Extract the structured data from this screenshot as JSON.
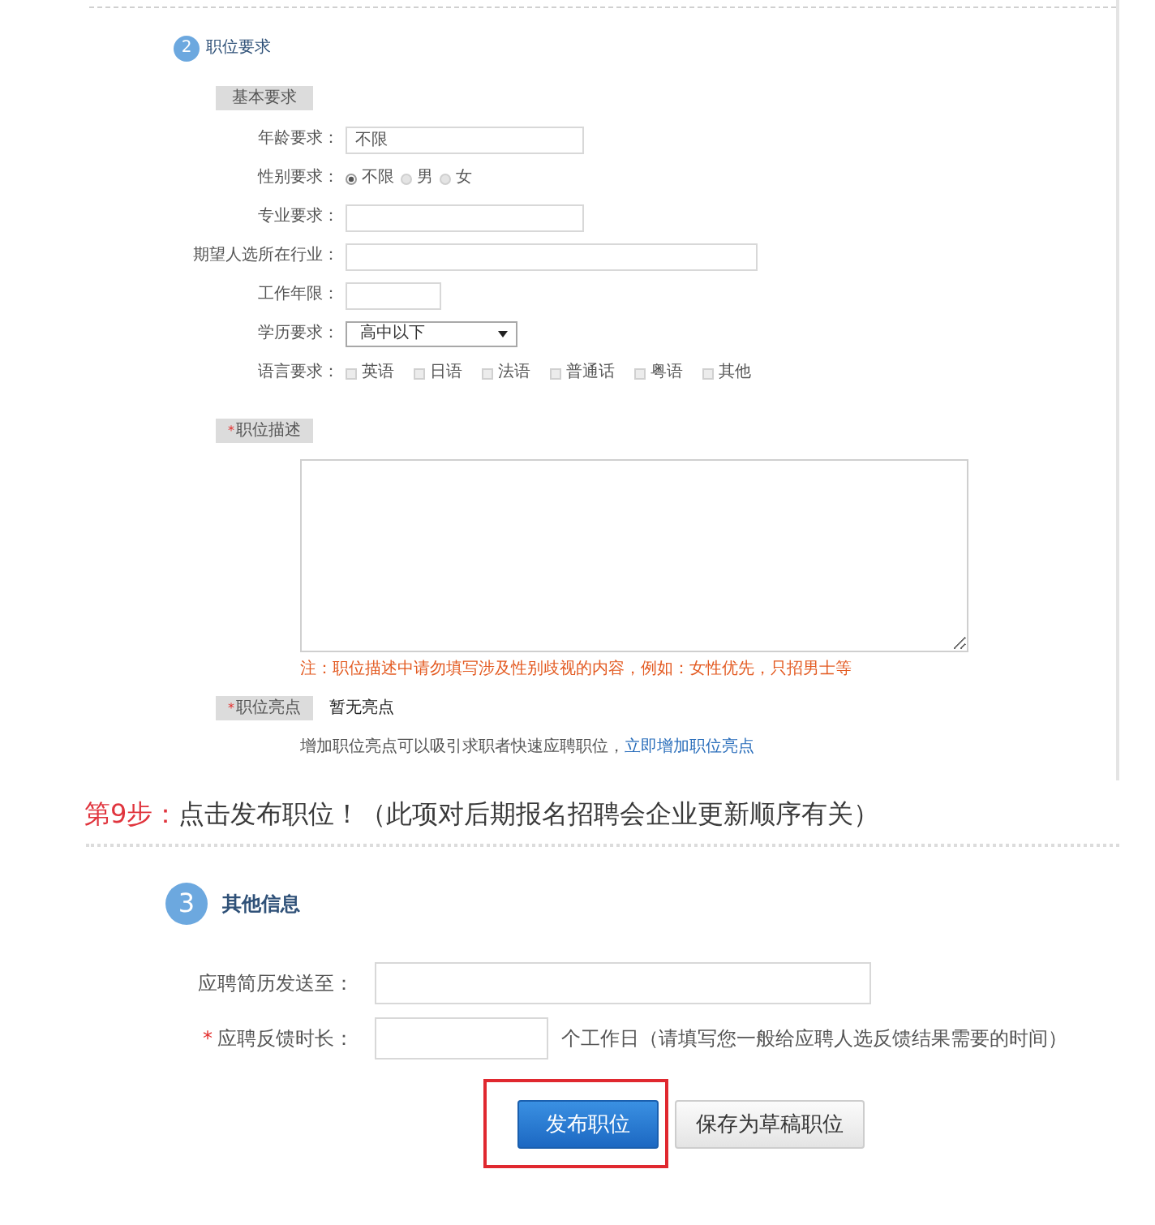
{
  "requirements_section": {
    "number": "2",
    "title": "职位要求",
    "basic_tab": {
      "label": "基本要求"
    },
    "fields": [
      {
        "kind": "text",
        "label": "年龄要求：",
        "value": "不限"
      },
      {
        "kind": "radio",
        "label": "性别要求：",
        "options": [
          {
            "label": "不限",
            "selected": true
          },
          {
            "label": "男",
            "selected": false
          },
          {
            "label": "女",
            "selected": false
          }
        ]
      },
      {
        "kind": "text",
        "label": "专业要求："
      },
      {
        "kind": "wide",
        "label": "期望人选所在行业："
      },
      {
        "kind": "short",
        "label": "工作年限："
      },
      {
        "kind": "select",
        "label": "学历要求：",
        "value": "高中以下"
      },
      {
        "kind": "checkbox",
        "label": "语言要求：",
        "options": [
          {
            "label": "英语",
            "checked": false
          },
          {
            "label": "日语",
            "checked": false
          },
          {
            "label": "法语",
            "checked": false
          },
          {
            "label": "普通话",
            "checked": false
          },
          {
            "label": "粤语",
            "checked": false
          },
          {
            "label": "其他",
            "checked": false
          }
        ]
      }
    ],
    "description": {
      "tab": {
        "label": "职位描述",
        "mark": "*"
      },
      "note": "注：职位描述中请勿填写涉及性别歧视的内容，例如：女性优先，只招男士等"
    },
    "highlights": {
      "tab": {
        "label": "职位亮点",
        "mark": "*"
      },
      "value": "暂无亮点",
      "hint": "增加职位亮点可以吸引求职者快速应聘职位，",
      "link": "立即增加职位亮点"
    }
  },
  "step_caption": {
    "step": "第9步：",
    "text": "点击发布职位！（此项对后期报名招聘会企业更新顺序有关）"
  },
  "other_section": {
    "number": "3",
    "title": "其他信息",
    "fields": [
      {
        "kind": "text",
        "label": "应聘简历发送至："
      },
      {
        "kind": "short",
        "label": "应聘反馈时长：",
        "mark": "*",
        "suffix": "个工作日（请填写您一般给应聘人选反馈结果需要的时间）"
      }
    ],
    "buttons": [
      {
        "kind": "primary",
        "label": "发布职位",
        "highlighted": true
      },
      {
        "kind": "secondary",
        "label": "保存为草稿职位",
        "highlighted": false
      }
    ]
  }
}
